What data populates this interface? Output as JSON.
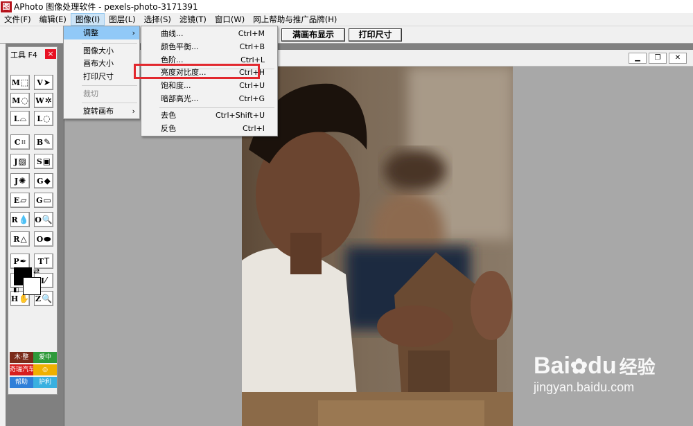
{
  "window": {
    "title": "APhoto 图像处理软件 - pexels-photo-3171391",
    "icon": "图"
  },
  "menubar": [
    "文件(F)",
    "编辑(E)",
    "图像(I)",
    "图层(L)",
    "选择(S)",
    "滤镜(T)",
    "窗口(W)",
    "网上帮助与推广品牌(H)"
  ],
  "toolbar": {
    "fit_label": "满画布显示",
    "print_label": "打印尺寸"
  },
  "toolpanel": {
    "title": "工具 F4",
    "close": "×",
    "tools": [
      {
        "key": "M",
        "glyph": "⬚"
      },
      {
        "key": "V",
        "glyph": "➤"
      },
      {
        "key": "M",
        "glyph": "◌"
      },
      {
        "key": "W",
        "glyph": "✲"
      },
      {
        "key": "L",
        "glyph": "⌓"
      },
      {
        "key": "L",
        "glyph": "◌"
      },
      {
        "key": "C",
        "glyph": "⌗"
      },
      {
        "key": "B",
        "glyph": "✎"
      },
      {
        "key": "J",
        "glyph": "▨"
      },
      {
        "key": "S",
        "glyph": "▣"
      },
      {
        "key": "J",
        "glyph": "✺"
      },
      {
        "key": "G",
        "glyph": "◆"
      },
      {
        "key": "E",
        "glyph": "▱"
      },
      {
        "key": "G",
        "glyph": "▭"
      },
      {
        "key": "R",
        "glyph": "💧"
      },
      {
        "key": "O",
        "glyph": "🔍"
      },
      {
        "key": "R",
        "glyph": "△"
      },
      {
        "key": "O",
        "glyph": "⬬"
      },
      {
        "key": "P",
        "glyph": "✒"
      },
      {
        "key": "T",
        "glyph": "T"
      },
      {
        "key": "I",
        "glyph": "▧"
      },
      {
        "key": "I",
        "glyph": "⁄"
      },
      {
        "key": "H",
        "glyph": "✋"
      },
      {
        "key": "Z",
        "glyph": "🔍"
      }
    ],
    "ads": [
      {
        "label": "木·整",
        "color": "#7a2b1a"
      },
      {
        "label": "爱中",
        "color": "#2e9a3a"
      },
      {
        "label": "奇瑞汽车",
        "color": "#d81e1e"
      },
      {
        "label": "◎",
        "color": "#f0b000"
      },
      {
        "label": "帮助",
        "color": "#2f7fd8"
      },
      {
        "label": "护利",
        "color": "#39b0e0"
      }
    ]
  },
  "menu_image": {
    "items": [
      {
        "label": "调整",
        "arrow": "›",
        "highlighted": true
      },
      {
        "label": "图像大小"
      },
      {
        "label": "画布大小"
      },
      {
        "label": "打印尺寸"
      },
      {
        "label": "裁切",
        "disabled": true
      },
      {
        "label": "旋转画布",
        "arrow": "›"
      }
    ]
  },
  "menu_adjust": {
    "items": [
      {
        "label": "曲线...",
        "shortcut": "Ctrl+M"
      },
      {
        "label": "颜色平衡...",
        "shortcut": "Ctrl+B"
      },
      {
        "label": "色阶...",
        "shortcut": "Ctrl+L"
      },
      {
        "label": "亮度对比度...",
        "shortcut": "Ctrl+H"
      },
      {
        "label": "饱和度...",
        "shortcut": "Ctrl+U"
      },
      {
        "label": "暗部高光...",
        "shortcut": "Ctrl+G"
      },
      {
        "label": "去色",
        "shortcut": "Ctrl+Shift+U"
      },
      {
        "label": "反色",
        "shortcut": "Ctrl+I"
      }
    ]
  },
  "watermark": {
    "brand": "Bai",
    "brand2": "du",
    "cn": "经验",
    "url": "jingyan.baidu.com"
  },
  "colors": {
    "accent_highlight": "#91c9f7",
    "annotation": "#e2282e"
  }
}
